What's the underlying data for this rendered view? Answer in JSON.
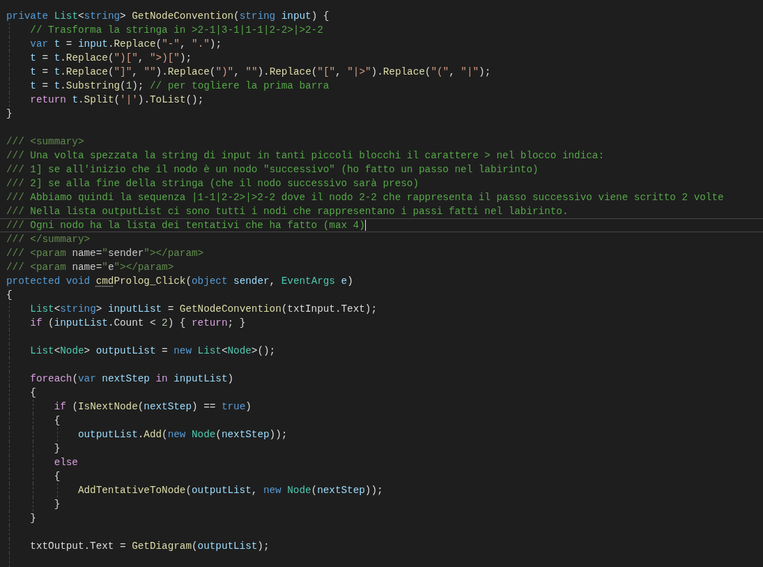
{
  "editor": {
    "lines": [
      {
        "current": false,
        "tokens": [
          {
            "kind": "kw",
            "text": "private "
          },
          {
            "kind": "type",
            "text": "List"
          },
          {
            "kind": "plain",
            "text": "<"
          },
          {
            "kind": "kw",
            "text": "string"
          },
          {
            "kind": "plain",
            "text": "> "
          },
          {
            "kind": "method",
            "text": "GetNodeConvention"
          },
          {
            "kind": "plain",
            "text": "("
          },
          {
            "kind": "kw",
            "text": "string "
          },
          {
            "kind": "var",
            "text": "input"
          },
          {
            "kind": "plain",
            "text": ") {"
          }
        ]
      },
      {
        "current": false,
        "tokens": [
          {
            "kind": "cmt",
            "text": "    // Trasforma la stringa in >2-1|3-1|1-1|2-2>|>2-2"
          }
        ]
      },
      {
        "current": false,
        "tokens": [
          {
            "kind": "kw",
            "text": "    var "
          },
          {
            "kind": "var",
            "text": "t"
          },
          {
            "kind": "plain",
            "text": " = "
          },
          {
            "kind": "var",
            "text": "input"
          },
          {
            "kind": "plain",
            "text": "."
          },
          {
            "kind": "method",
            "text": "Replace"
          },
          {
            "kind": "plain",
            "text": "("
          },
          {
            "kind": "str",
            "text": "\"-\""
          },
          {
            "kind": "plain",
            "text": ", "
          },
          {
            "kind": "str",
            "text": "\".\""
          },
          {
            "kind": "plain",
            "text": ");"
          }
        ]
      },
      {
        "current": false,
        "tokens": [
          {
            "kind": "var",
            "text": "    t"
          },
          {
            "kind": "plain",
            "text": " = "
          },
          {
            "kind": "var",
            "text": "t"
          },
          {
            "kind": "plain",
            "text": "."
          },
          {
            "kind": "method",
            "text": "Replace"
          },
          {
            "kind": "plain",
            "text": "("
          },
          {
            "kind": "str",
            "text": "\")[\""
          },
          {
            "kind": "plain",
            "text": ", "
          },
          {
            "kind": "str",
            "text": "\">)[\""
          },
          {
            "kind": "plain",
            "text": ");"
          }
        ]
      },
      {
        "current": false,
        "tokens": [
          {
            "kind": "var",
            "text": "    t"
          },
          {
            "kind": "plain",
            "text": " = "
          },
          {
            "kind": "var",
            "text": "t"
          },
          {
            "kind": "plain",
            "text": "."
          },
          {
            "kind": "method",
            "text": "Replace"
          },
          {
            "kind": "plain",
            "text": "("
          },
          {
            "kind": "str",
            "text": "\"]\""
          },
          {
            "kind": "plain",
            "text": ", "
          },
          {
            "kind": "str",
            "text": "\"\""
          },
          {
            "kind": "plain",
            "text": ")."
          },
          {
            "kind": "method",
            "text": "Replace"
          },
          {
            "kind": "plain",
            "text": "("
          },
          {
            "kind": "str",
            "text": "\")\""
          },
          {
            "kind": "plain",
            "text": ", "
          },
          {
            "kind": "str",
            "text": "\"\""
          },
          {
            "kind": "plain",
            "text": ")."
          },
          {
            "kind": "method",
            "text": "Replace"
          },
          {
            "kind": "plain",
            "text": "("
          },
          {
            "kind": "str",
            "text": "\"[\""
          },
          {
            "kind": "plain",
            "text": ", "
          },
          {
            "kind": "str",
            "text": "\"|>\""
          },
          {
            "kind": "plain",
            "text": ")."
          },
          {
            "kind": "method",
            "text": "Replace"
          },
          {
            "kind": "plain",
            "text": "("
          },
          {
            "kind": "str",
            "text": "\"(\""
          },
          {
            "kind": "plain",
            "text": ", "
          },
          {
            "kind": "str",
            "text": "\"|\""
          },
          {
            "kind": "plain",
            "text": ");"
          }
        ]
      },
      {
        "current": false,
        "tokens": [
          {
            "kind": "var",
            "text": "    t"
          },
          {
            "kind": "plain",
            "text": " = "
          },
          {
            "kind": "var",
            "text": "t"
          },
          {
            "kind": "plain",
            "text": "."
          },
          {
            "kind": "method",
            "text": "Substring"
          },
          {
            "kind": "plain",
            "text": "("
          },
          {
            "kind": "num",
            "text": "1"
          },
          {
            "kind": "plain",
            "text": "); "
          },
          {
            "kind": "cmt",
            "text": "// per togliere la prima barra"
          }
        ]
      },
      {
        "current": false,
        "tokens": [
          {
            "kind": "ctl",
            "text": "    return "
          },
          {
            "kind": "var",
            "text": "t"
          },
          {
            "kind": "plain",
            "text": "."
          },
          {
            "kind": "method",
            "text": "Split"
          },
          {
            "kind": "plain",
            "text": "("
          },
          {
            "kind": "str",
            "text": "'|'"
          },
          {
            "kind": "plain",
            "text": ")."
          },
          {
            "kind": "method",
            "text": "ToList"
          },
          {
            "kind": "plain",
            "text": "();"
          }
        ]
      },
      {
        "current": false,
        "tokens": [
          {
            "kind": "plain",
            "text": "}"
          }
        ]
      },
      {
        "current": false
      },
      {
        "current": false,
        "tokens": [
          {
            "kind": "doc",
            "text": "/// <summary>"
          }
        ]
      },
      {
        "current": false,
        "tokens": [
          {
            "kind": "doc",
            "text": "/// "
          },
          {
            "kind": "doctext",
            "text": "Una volta spezzata la string di input in tanti piccoli blocchi il carattere > nel blocco indica:"
          }
        ]
      },
      {
        "current": false,
        "tokens": [
          {
            "kind": "doc",
            "text": "/// "
          },
          {
            "kind": "doctext",
            "text": "1] se all'inizio che il nodo è un nodo \"successivo\" (ho fatto un passo nel labirinto)"
          }
        ]
      },
      {
        "current": false,
        "tokens": [
          {
            "kind": "doc",
            "text": "/// "
          },
          {
            "kind": "doctext",
            "text": "2] se alla fine della stringa (che il nodo successivo sarà preso)"
          }
        ]
      },
      {
        "current": false,
        "tokens": [
          {
            "kind": "doc",
            "text": "/// "
          },
          {
            "kind": "doctext",
            "text": "Abbiamo quindi la sequenza |1-1|2-2>|>2-2 dove il nodo 2-2 che rappresenta il passo successivo viene scritto 2 volte"
          }
        ]
      },
      {
        "current": false,
        "tokens": [
          {
            "kind": "doc",
            "text": "/// "
          },
          {
            "kind": "doctext",
            "text": "Nella lista outputList ci sono tutti i nodi che rappresentano i passi fatti nel labirinto."
          }
        ]
      },
      {
        "current": true,
        "tokens": [
          {
            "kind": "doc",
            "text": "/// "
          },
          {
            "kind": "doctext",
            "text": "Ogni nodo ha la lista dei tentativi che ha fatto (max 4)"
          }
        ]
      },
      {
        "current": false,
        "tokens": [
          {
            "kind": "doc",
            "text": "/// </summary>"
          }
        ]
      },
      {
        "current": false,
        "tokens": [
          {
            "kind": "doc",
            "text": "/// <param "
          },
          {
            "kind": "docattr",
            "text": "name="
          },
          {
            "kind": "doc",
            "text": "\""
          },
          {
            "kind": "docattr",
            "text": "sender"
          },
          {
            "kind": "doc",
            "text": "\"></param>"
          }
        ]
      },
      {
        "current": false,
        "tokens": [
          {
            "kind": "doc",
            "text": "/// <param "
          },
          {
            "kind": "docattr",
            "text": "name="
          },
          {
            "kind": "doc",
            "text": "\""
          },
          {
            "kind": "docattr",
            "text": "e"
          },
          {
            "kind": "doc",
            "text": "\"></param>"
          }
        ]
      },
      {
        "current": false,
        "tokens": [
          {
            "kind": "kw",
            "text": "protected void "
          },
          {
            "kind": "hint",
            "text": "cmd"
          },
          {
            "kind": "method",
            "text": "Prolog_Click"
          },
          {
            "kind": "plain",
            "text": "("
          },
          {
            "kind": "kw",
            "text": "object "
          },
          {
            "kind": "var",
            "text": "sender"
          },
          {
            "kind": "plain",
            "text": ", "
          },
          {
            "kind": "type",
            "text": "EventArgs "
          },
          {
            "kind": "var",
            "text": "e"
          },
          {
            "kind": "plain",
            "text": ")"
          }
        ]
      },
      {
        "current": false,
        "tokens": [
          {
            "kind": "plain",
            "text": "{"
          }
        ]
      },
      {
        "current": false,
        "tokens": [
          {
            "kind": "type",
            "text": "    List"
          },
          {
            "kind": "plain",
            "text": "<"
          },
          {
            "kind": "kw",
            "text": "string"
          },
          {
            "kind": "plain",
            "text": "> "
          },
          {
            "kind": "var",
            "text": "inputList"
          },
          {
            "kind": "plain",
            "text": " = "
          },
          {
            "kind": "method",
            "text": "GetNodeConvention"
          },
          {
            "kind": "plain",
            "text": "(txtInput.Text);"
          }
        ]
      },
      {
        "current": false,
        "tokens": [
          {
            "kind": "ctl",
            "text": "    if"
          },
          {
            "kind": "plain",
            "text": " ("
          },
          {
            "kind": "var",
            "text": "inputList"
          },
          {
            "kind": "plain",
            "text": ".Count < "
          },
          {
            "kind": "num",
            "text": "2"
          },
          {
            "kind": "plain",
            "text": ") { "
          },
          {
            "kind": "ctl",
            "text": "return"
          },
          {
            "kind": "plain",
            "text": "; }"
          }
        ]
      },
      {
        "current": false
      },
      {
        "current": false,
        "tokens": [
          {
            "kind": "type",
            "text": "    List"
          },
          {
            "kind": "plain",
            "text": "<"
          },
          {
            "kind": "type",
            "text": "Node"
          },
          {
            "kind": "plain",
            "text": "> "
          },
          {
            "kind": "var",
            "text": "outputList"
          },
          {
            "kind": "plain",
            "text": " = "
          },
          {
            "kind": "kw",
            "text": "new "
          },
          {
            "kind": "type",
            "text": "List"
          },
          {
            "kind": "plain",
            "text": "<"
          },
          {
            "kind": "type",
            "text": "Node"
          },
          {
            "kind": "plain",
            "text": ">();"
          }
        ]
      },
      {
        "current": false
      },
      {
        "current": false,
        "tokens": [
          {
            "kind": "ctl",
            "text": "    foreach"
          },
          {
            "kind": "plain",
            "text": "("
          },
          {
            "kind": "kw",
            "text": "var "
          },
          {
            "kind": "var",
            "text": "nextStep"
          },
          {
            "kind": "ctl",
            "text": " in "
          },
          {
            "kind": "var",
            "text": "inputList"
          },
          {
            "kind": "plain",
            "text": ")"
          }
        ]
      },
      {
        "current": false,
        "tokens": [
          {
            "kind": "plain",
            "text": "    {"
          }
        ]
      },
      {
        "current": false,
        "tokens": [
          {
            "kind": "ctl",
            "text": "        if"
          },
          {
            "kind": "plain",
            "text": " ("
          },
          {
            "kind": "method",
            "text": "IsNextNode"
          },
          {
            "kind": "plain",
            "text": "("
          },
          {
            "kind": "var",
            "text": "nextStep"
          },
          {
            "kind": "plain",
            "text": ") == "
          },
          {
            "kind": "kw",
            "text": "true"
          },
          {
            "kind": "plain",
            "text": ")"
          }
        ]
      },
      {
        "current": false,
        "tokens": [
          {
            "kind": "plain",
            "text": "        {"
          }
        ]
      },
      {
        "current": false,
        "tokens": [
          {
            "kind": "var",
            "text": "            outputList"
          },
          {
            "kind": "plain",
            "text": "."
          },
          {
            "kind": "method",
            "text": "Add"
          },
          {
            "kind": "plain",
            "text": "("
          },
          {
            "kind": "kw",
            "text": "new "
          },
          {
            "kind": "type",
            "text": "Node"
          },
          {
            "kind": "plain",
            "text": "("
          },
          {
            "kind": "var",
            "text": "nextStep"
          },
          {
            "kind": "plain",
            "text": "));"
          }
        ]
      },
      {
        "current": false,
        "tokens": [
          {
            "kind": "plain",
            "text": "        }"
          }
        ]
      },
      {
        "current": false,
        "tokens": [
          {
            "kind": "ctl",
            "text": "        else"
          }
        ]
      },
      {
        "current": false,
        "tokens": [
          {
            "kind": "plain",
            "text": "        {"
          }
        ]
      },
      {
        "current": false,
        "tokens": [
          {
            "kind": "method",
            "text": "            AddTentativeToNode"
          },
          {
            "kind": "plain",
            "text": "("
          },
          {
            "kind": "var",
            "text": "outputList"
          },
          {
            "kind": "plain",
            "text": ", "
          },
          {
            "kind": "kw",
            "text": "new "
          },
          {
            "kind": "type",
            "text": "Node"
          },
          {
            "kind": "plain",
            "text": "("
          },
          {
            "kind": "var",
            "text": "nextStep"
          },
          {
            "kind": "plain",
            "text": "));"
          }
        ]
      },
      {
        "current": false,
        "tokens": [
          {
            "kind": "plain",
            "text": "        }"
          }
        ]
      },
      {
        "current": false,
        "tokens": [
          {
            "kind": "plain",
            "text": "    }"
          }
        ]
      },
      {
        "current": false
      },
      {
        "current": false,
        "tokens": [
          {
            "kind": "plain",
            "text": "    txtOutput.Text = "
          },
          {
            "kind": "method",
            "text": "GetDiagram"
          },
          {
            "kind": "plain",
            "text": "("
          },
          {
            "kind": "var",
            "text": "outputList"
          },
          {
            "kind": "plain",
            "text": ");"
          }
        ]
      },
      {
        "current": false
      }
    ]
  }
}
